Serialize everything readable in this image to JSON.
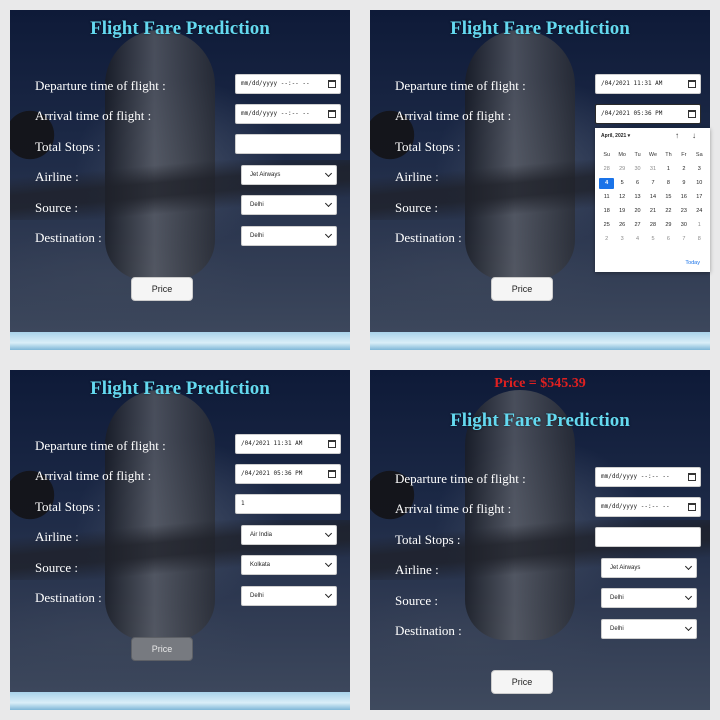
{
  "panels": [
    {
      "title": "Flight Fare Prediction",
      "labels": [
        "Departure time of flight :",
        "Arrival time of flight :",
        "Total Stops :",
        "Airline :",
        "Source :",
        "Destination :"
      ],
      "departure_value": "mm/dd/yyyy --:-- --",
      "arrival_value": "mm/dd/yyyy --:-- --",
      "stops_value": "",
      "airline": "Jet Airways",
      "source": "Delhi",
      "destination": "Delhi",
      "button": "Price"
    },
    {
      "title": "Flight Fare Prediction",
      "labels": [
        "Departure time of flight :",
        "Arrival time of flight :",
        "Total Stops :",
        "Airline :",
        "Source :",
        "Destination :"
      ],
      "departure_value": "/04/2021 11:31 AM",
      "arrival_value": "/04/2021 05:36 PM",
      "button": "Price",
      "datepicker": {
        "month_label": "April, 2021 ▾",
        "prev": "↑",
        "next": "↓",
        "weekdays": [
          "Su",
          "Mo",
          "Tu",
          "We",
          "Th",
          "Fr",
          "Sa"
        ],
        "days": [
          "28",
          "29",
          "30",
          "31",
          "1",
          "2",
          "3",
          "4",
          "5",
          "6",
          "7",
          "8",
          "9",
          "10",
          "11",
          "12",
          "13",
          "14",
          "15",
          "16",
          "17",
          "18",
          "19",
          "20",
          "21",
          "22",
          "23",
          "24",
          "25",
          "26",
          "27",
          "28",
          "29",
          "30",
          "1",
          "2",
          "3",
          "4",
          "5",
          "6",
          "7",
          "8"
        ],
        "selected": "4",
        "today": "Today"
      }
    },
    {
      "title": "Flight Fare Prediction",
      "labels": [
        "Departure time of flight :",
        "Arrival time of flight :",
        "Total Stops :",
        "Airline :",
        "Source :",
        "Destination :"
      ],
      "departure_value": "/04/2021 11:31 AM",
      "arrival_value": "/04/2021 05:36 PM",
      "stops_value": "1",
      "airline": "Air India",
      "source": "Kolkata",
      "destination": "Delhi",
      "button": "Price"
    },
    {
      "price_result": "Price = $545.39",
      "title": "Flight Fare Prediction",
      "labels": [
        "Departure time of flight :",
        "Arrival time of flight :",
        "Total Stops :",
        "Airline :",
        "Source :",
        "Destination :"
      ],
      "departure_value": "mm/dd/yyyy --:-- --",
      "arrival_value": "mm/dd/yyyy --:-- --",
      "stops_value": "",
      "airline": "Jet Airways",
      "source": "Delhi",
      "destination": "Delhi",
      "button": "Price"
    }
  ],
  "colors": {
    "title": "#64d9f0",
    "price_result": "#e02020",
    "selected_day": "#1a73e8"
  }
}
